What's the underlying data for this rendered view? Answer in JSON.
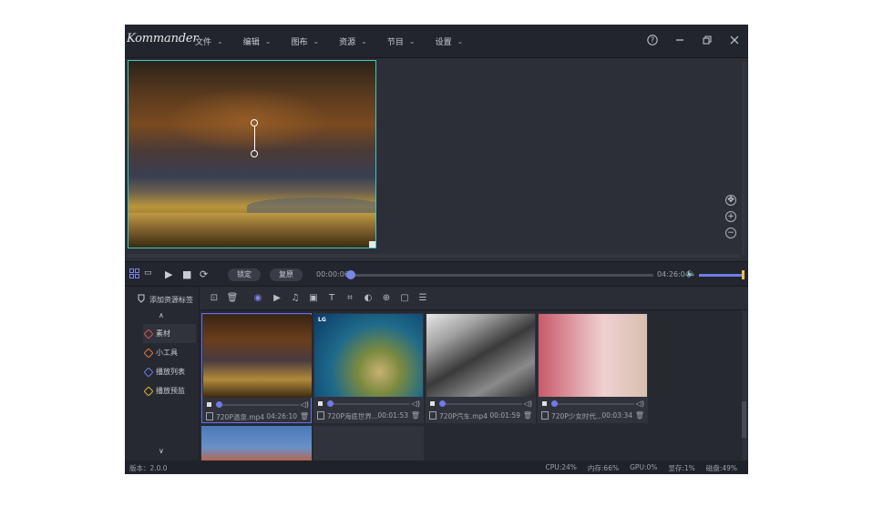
{
  "app": {
    "logo": "Kommander",
    "menu": [
      "文件",
      "编辑",
      "图布",
      "资源",
      "节目",
      "设置"
    ]
  },
  "transport": {
    "lock_label": "锁定",
    "restore_label": "复原",
    "current_time": "00:00:06",
    "total_time": "04:26:04",
    "progress": 0.0
  },
  "sidebar": {
    "add_source": "添加资源标签",
    "items": [
      {
        "label": "素材",
        "color": "#e05050"
      },
      {
        "label": "小工具",
        "color": "#e07a3a"
      },
      {
        "label": "播放列表",
        "color": "#7a7ae8"
      },
      {
        "label": "播放预监",
        "color": "#e0b83a"
      }
    ]
  },
  "media": [
    {
      "name": "720P温泉.mp4",
      "duration": "04:26:10",
      "badge": ""
    },
    {
      "name": "720P海底世界...",
      "duration": "00:01:53",
      "badge": "LG"
    },
    {
      "name": "720P汽车.mp4",
      "duration": "00:01:59",
      "badge": ""
    },
    {
      "name": "720P少女时代...",
      "duration": "00:03:34",
      "badge": ""
    }
  ],
  "status": {
    "version": "版本：2.0.0",
    "cpu": "CPU:24%",
    "memory": "内存:66%",
    "gpu": "GPU:0%",
    "vram": "显存:1%",
    "disk": "磁盘:49%"
  },
  "colors": {
    "accent": "#6a6ff0",
    "frame_border": "#3fc7c2",
    "volume": "#6f7de6"
  }
}
